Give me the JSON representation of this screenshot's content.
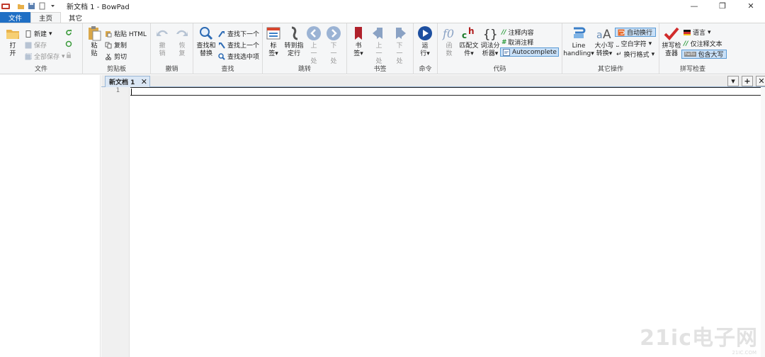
{
  "window": {
    "title": "新文档 1 - BowPad",
    "controls": {
      "minimize": "—",
      "maximize": "❐",
      "close": "✕"
    }
  },
  "ribbon_tabs": {
    "file": "文件",
    "home": "主页",
    "other": "其它"
  },
  "groups": {
    "file": {
      "label": "文件",
      "open": "打开",
      "new": "新建",
      "save": "保存",
      "save_all": "全部保存"
    },
    "clipboard": {
      "label": "剪贴板",
      "paste": "粘贴",
      "paste_html": "粘贴 HTML",
      "copy": "复制",
      "cut": "剪切"
    },
    "undo": {
      "label": "撤销",
      "undo": "撤销",
      "redo": "恢复"
    },
    "find": {
      "label": "查找",
      "find_replace": "查找和替换",
      "find_next": "查找下一个",
      "find_prev": "查找上一个",
      "find_selected": "查找选中项"
    },
    "goto": {
      "label": "跳转",
      "tags": "标签",
      "goto_line": "转到指定行",
      "prev": "上一处",
      "next": "下一处"
    },
    "bookmarks": {
      "label": "书签",
      "bookmark": "书签",
      "prev": "上一处",
      "next": "下一处"
    },
    "command": {
      "label": "命令",
      "run": "运行"
    },
    "code": {
      "label": "代码",
      "function": "函数",
      "match_file": "匹配文件",
      "lexer": "词法分析器",
      "comment": "注释内容",
      "uncomment": "取消注释",
      "autocomplete": "Autocomplete"
    },
    "other_ops": {
      "label": "其它操作",
      "line_handling": "Line handling",
      "case_convert": "大小写转换",
      "auto_wrap": "自动换行",
      "whitespace": "空白字符",
      "line_format": "换行格式"
    },
    "spell": {
      "label": "拼写检查",
      "checker": "拼写检查器",
      "language": "语言",
      "comments_only": "仅注释文本",
      "include_caps": "包含大写"
    }
  },
  "document": {
    "tab_label": "新文档 1",
    "close": "✕",
    "line_number": "1"
  },
  "tabbar_buttons": {
    "dropdown": "▾",
    "add": "+",
    "close": "✕"
  },
  "watermark": {
    "text": "21ic电子网",
    "sub": "21IC.COM"
  },
  "colors": {
    "file_tab": "#1f6fc5",
    "ribbon_bg": "#f5f6f7",
    "highlight": "#c9e0f7"
  }
}
